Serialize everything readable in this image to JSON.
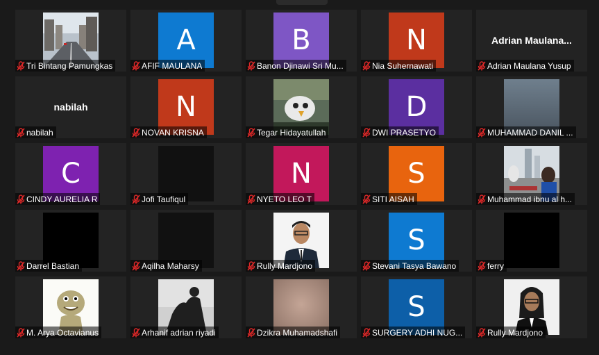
{
  "participants": [
    {
      "name": "Tri Bintang Pamungkas",
      "type": "photo",
      "photo": "street"
    },
    {
      "name": "AFIF MAULANA",
      "type": "initial",
      "initial": "A",
      "color": "#0e7ad1"
    },
    {
      "name": "Banon Djinawi Sri Mu...",
      "type": "initial",
      "initial": "B",
      "color": "#7e56c5"
    },
    {
      "name": "Nia Suhernawati",
      "type": "initial",
      "initial": "N",
      "color": "#c0391b"
    },
    {
      "name": "Adrian Maulana Yusup",
      "type": "text",
      "display": "Adrian  Maulana..."
    },
    {
      "name": "nabilah",
      "type": "text",
      "display": "nabilah"
    },
    {
      "name": "NOVAN KRISNA",
      "type": "initial",
      "initial": "N",
      "color": "#c0391b"
    },
    {
      "name": "Tegar Hidayatullah",
      "type": "photo",
      "photo": "cartoon-bird"
    },
    {
      "name": "DWI PRASETYO",
      "type": "initial",
      "initial": "D",
      "color": "#5b2fa0"
    },
    {
      "name": "MUHAMMAD DANIL ...",
      "type": "photo",
      "photo": "blurred-gray"
    },
    {
      "name": "CINDY AURELIA R",
      "type": "initial",
      "initial": "C",
      "color": "#7e22b0"
    },
    {
      "name": "Jofi Taufiqul",
      "type": "photo",
      "photo": "dark"
    },
    {
      "name": "NYETO LEO T",
      "type": "initial",
      "initial": "N",
      "color": "#c2185b"
    },
    {
      "name": "SITI AISAH",
      "type": "initial",
      "initial": "S",
      "color": "#e8640e"
    },
    {
      "name": "Muhammad ibnu al h...",
      "type": "photo",
      "photo": "city"
    },
    {
      "name": "Darrel Bastian",
      "type": "photo",
      "photo": "black"
    },
    {
      "name": "Aqilha Maharsy",
      "type": "photo",
      "photo": "dark"
    },
    {
      "name": "Rully Mardjono",
      "type": "photo",
      "photo": "portrait-suit"
    },
    {
      "name": "Stevani Tasya Bawano",
      "type": "initial",
      "initial": "S",
      "color": "#0e7ad1"
    },
    {
      "name": "ferry",
      "type": "photo",
      "photo": "black"
    },
    {
      "name": "M. Arya Octavianus",
      "type": "photo",
      "photo": "cartoon-lizard"
    },
    {
      "name": "Arhanif adrian riyadi",
      "type": "photo",
      "photo": "silhouette"
    },
    {
      "name": "Dzikra Muhamadshafi",
      "type": "photo",
      "photo": "blurred-skin"
    },
    {
      "name": "SURGERY ADHI NUG...",
      "type": "initial",
      "initial": "S",
      "color": "#0d5fa8"
    },
    {
      "name": "Rully Mardjono",
      "type": "photo",
      "photo": "portrait-longhair"
    }
  ],
  "icons": {
    "muted": "muted-mic-icon",
    "muted_color": "#e02828"
  }
}
